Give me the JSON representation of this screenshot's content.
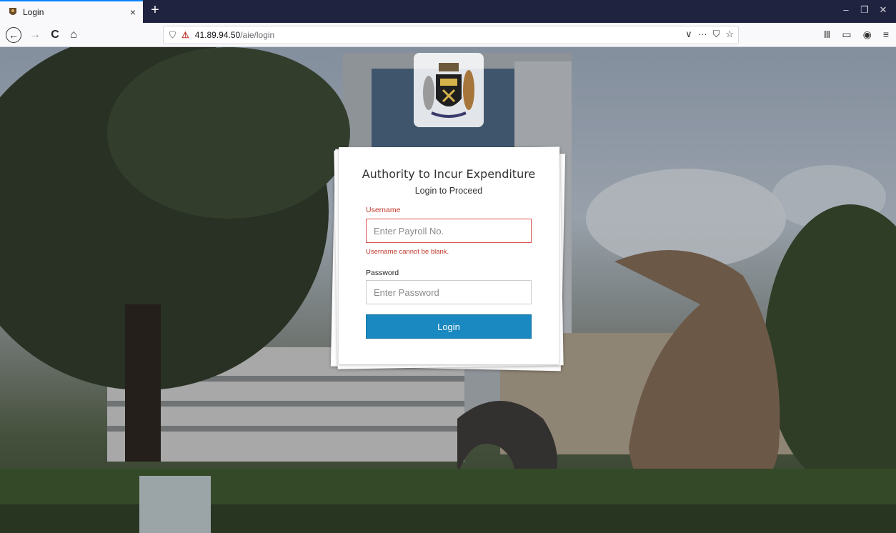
{
  "browser": {
    "tab_title": "Login",
    "url_host": "41.89.94.50",
    "url_path": "/aie/login",
    "icons": {
      "close": "×",
      "new_tab": "+",
      "minimize": "–",
      "restore": "❐",
      "window_close": "✕",
      "back": "←",
      "forward": "→",
      "reload": "C",
      "home": "⌂",
      "shield": "⛉",
      "insecure": "⚠",
      "dropdown": "∨",
      "more": "···",
      "pocket": "⛉",
      "star": "☆",
      "library": "Ⅲ",
      "sidebar": "▭",
      "account": "◉",
      "menu": "≡"
    }
  },
  "login": {
    "title": "Authority to Incur Expenditure",
    "subtitle": "Login to Proceed",
    "username_label": "Username",
    "username_placeholder": "Enter Payroll No.",
    "username_error": "Username cannot be blank.",
    "password_label": "Password",
    "password_placeholder": "Enter Password",
    "submit_label": "Login"
  },
  "colors": {
    "accent": "#1a88c1",
    "error": "#c0392b",
    "tabbar": "#202340"
  }
}
